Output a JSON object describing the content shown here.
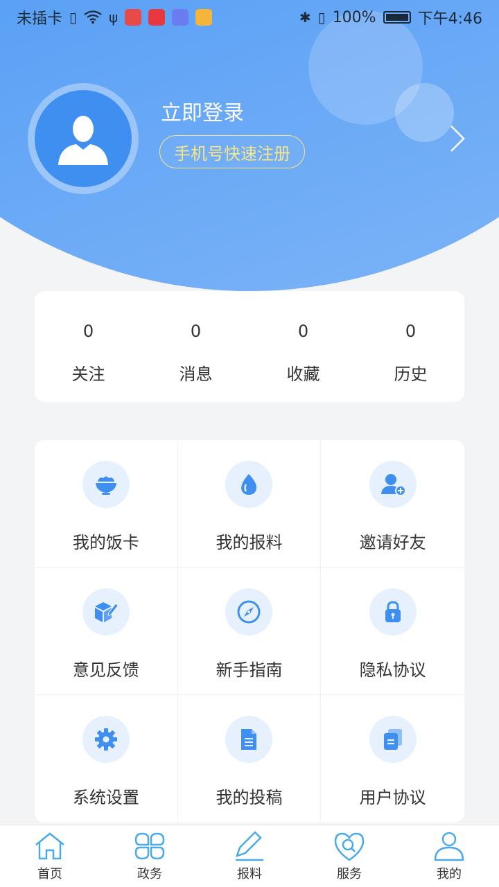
{
  "status_bar": {
    "carrier": "未插卡",
    "battery": "100%",
    "time": "下午4:46"
  },
  "profile": {
    "login_title": "立即登录",
    "register_label": "手机号快速注册"
  },
  "stats": [
    {
      "value": "0",
      "label": "关注"
    },
    {
      "value": "0",
      "label": "消息"
    },
    {
      "value": "0",
      "label": "收藏"
    },
    {
      "value": "0",
      "label": "历史"
    }
  ],
  "menu": [
    {
      "label": "我的饭卡",
      "icon": "rice-bowl-icon"
    },
    {
      "label": "我的报料",
      "icon": "drop-icon"
    },
    {
      "label": "邀请好友",
      "icon": "add-user-icon"
    },
    {
      "label": "意见反馈",
      "icon": "feedback-box-icon"
    },
    {
      "label": "新手指南",
      "icon": "compass-icon"
    },
    {
      "label": "隐私协议",
      "icon": "lock-icon"
    },
    {
      "label": "系统设置",
      "icon": "gear-icon"
    },
    {
      "label": "我的投稿",
      "icon": "document-icon"
    },
    {
      "label": "用户协议",
      "icon": "stacked-docs-icon"
    }
  ],
  "nav": [
    {
      "label": "首页",
      "icon": "home-icon"
    },
    {
      "label": "政务",
      "icon": "clover-icon"
    },
    {
      "label": "报料",
      "icon": "pen-icon"
    },
    {
      "label": "服务",
      "icon": "heart-search-icon"
    },
    {
      "label": "我的",
      "icon": "person-icon"
    }
  ],
  "colors": {
    "brand_blue": "#4a90f2",
    "accent_yellow": "#f7e58a",
    "icon_blue": "#3f8ff0",
    "nav_icon": "#4aa9e8"
  }
}
